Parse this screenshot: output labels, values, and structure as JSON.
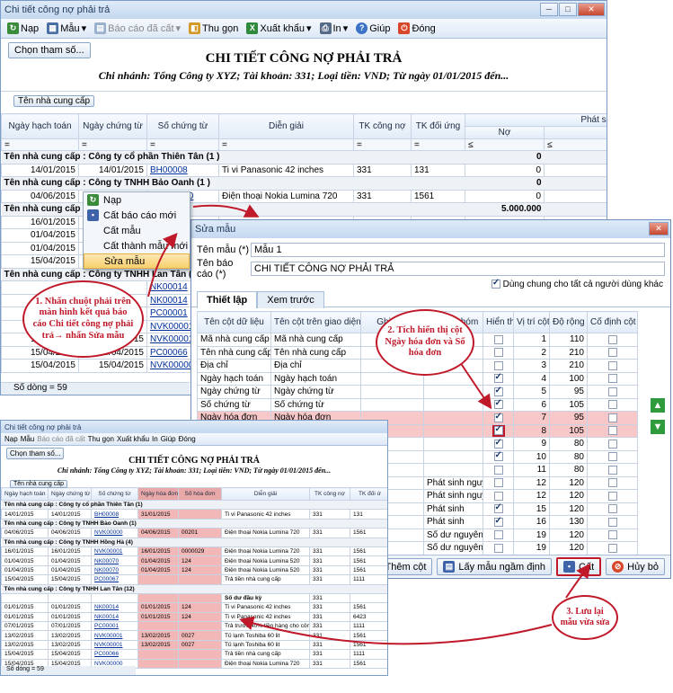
{
  "main": {
    "title": "Chi tiết công nợ phải trả",
    "toolbar": [
      "Nạp",
      "Mẫu",
      "Báo cáo đã cất",
      "Thu gọn",
      "Xuất khẩu",
      "In",
      "Giúp",
      "Đóng"
    ],
    "param_button": "Chọn tham số...",
    "report_title": "CHI TIẾT CÔNG NỢ PHẢI TRẢ",
    "report_sub": "Chi nhánh: Tổng Công ty XYZ; Tài khoản: 331; Loại tiền: VND; Từ ngày 01/01/2015 đến...",
    "group_chip": "Tên nhà cung cấp",
    "headers": [
      "Ngày hạch toán",
      "Ngày chứng từ",
      "Số chứng từ",
      "Diễn giải",
      "TK công nợ",
      "TK đối ứng",
      "Phát sinh",
      "Nợ",
      "Có"
    ],
    "filter_ops": [
      "=",
      "=",
      "=",
      "=",
      "=",
      "=",
      "≤",
      "≤"
    ],
    "rows": [
      {
        "g": "Tên nhà cung cấp : Công ty cổ phần Thiên Tân (1 )",
        "t": "0",
        "t2": "57"
      },
      {
        "d": [
          "14/01/2015",
          "14/01/2015",
          "BH00008",
          "Ti vi Panasonic 42 inches",
          "331",
          "131",
          "0",
          ""
        ]
      },
      {
        "g": "Tên nhà cung cấp : Công ty TNHH Bảo Oanh (1 )",
        "t": "0",
        "t2": "66"
      },
      {
        "d": [
          "04/06/2015",
          "",
          "NVK00000",
          "Điện thoại Nokia Lumina 720",
          "331",
          "1561",
          "0",
          ""
        ]
      },
      {
        "g": "Tên nhà cung cấp :",
        "t": "5.000.000",
        "t2": "80"
      },
      {
        "d": [
          "16/01/2015",
          "",
          "",
          "",
          "",
          "",
          "",
          ""
        ]
      },
      {
        "d": [
          "01/04/2015",
          "",
          "",
          "",
          "",
          "",
          "",
          ""
        ]
      },
      {
        "d": [
          "01/04/2015",
          "",
          "",
          "",
          "",
          "",
          "",
          ""
        ]
      },
      {
        "d": [
          "15/04/2015",
          "",
          "",
          "",
          "",
          "",
          "",
          ""
        ]
      },
      {
        "g": "Tên nhà cung cấp : Công ty TNHH Lan Tân (12)",
        "t": "",
        "t2": ""
      },
      {
        "d": [
          "",
          "",
          "NK00014",
          "",
          "",
          "",
          "",
          ""
        ]
      },
      {
        "d": [
          "",
          "",
          "NK00014",
          "",
          "",
          "",
          "",
          ""
        ]
      },
      {
        "d": [
          "",
          "",
          "PC00001",
          "",
          "",
          "",
          "",
          ""
        ]
      },
      {
        "d": [
          "",
          "",
          "NVK00001",
          "",
          "",
          "",
          "",
          ""
        ]
      },
      {
        "d": [
          "13/02/2015",
          "13/02/2015",
          "NVK00001",
          "",
          "",
          "",
          "",
          ""
        ]
      },
      {
        "d": [
          "15/04/2015",
          "15/04/2015",
          "PC00066",
          "",
          "",
          "",
          "",
          ""
        ]
      },
      {
        "d": [
          "15/04/2015",
          "15/04/2015",
          "NVK00000",
          "",
          "",
          "",
          "",
          ""
        ]
      }
    ],
    "footer": "Số dòng = 59"
  },
  "menu": {
    "items": [
      "Nạp",
      "Cất báo cáo mới",
      "Cất mẫu",
      "Cất thành mẫu mới",
      "Sửa mẫu"
    ]
  },
  "dialog": {
    "title": "Sửa mẫu",
    "name_label": "Tên mẫu (*)",
    "name_value": "Mẫu 1",
    "report_label": "Tên báo cáo (*)",
    "report_value": "CHI TIẾT CÔNG NỢ PHẢI TRẢ",
    "share_label": "Dùng chung cho tất cả người dùng khác",
    "tabs": [
      "Thiết lập",
      "Xem trước"
    ],
    "headers": [
      "Tên cột dữ liệu",
      "Tên cột trên giao diện",
      "Ghi chú",
      "Thuộc nhóm",
      "Hiển thị",
      "Vị trí cột",
      "Độ rộng",
      "Cố định cột"
    ],
    "rows": [
      [
        "Mã nhà cung cấp",
        "Mã nhà cung cấp",
        "",
        "",
        false,
        "1",
        "110",
        false
      ],
      [
        "Tên nhà cung cấp",
        "Tên nhà cung cấp",
        "",
        "",
        false,
        "2",
        "210",
        false
      ],
      [
        "Địa chỉ",
        "Địa chỉ",
        "",
        "",
        false,
        "3",
        "210",
        false
      ],
      [
        "Ngày hạch toán",
        "Ngày hạch toán",
        "",
        "",
        true,
        "4",
        "100",
        false
      ],
      [
        "Ngày chứng từ",
        "Ngày chứng từ",
        "",
        "",
        true,
        "5",
        "95",
        false
      ],
      [
        "Số chứng từ",
        "Số chứng từ",
        "",
        "",
        true,
        "6",
        "105",
        false
      ],
      [
        "Ngày hóa đơn",
        "Ngày hóa đơn",
        "",
        "",
        true,
        "7",
        "95",
        false
      ],
      [
        "Số hóa đơn",
        "Số hóa đơn",
        "",
        "",
        true,
        "8",
        "105",
        false
      ],
      [
        "",
        "",
        "",
        "",
        true,
        "9",
        "80",
        false
      ],
      [
        "",
        "",
        "",
        "",
        true,
        "10",
        "80",
        false
      ],
      [
        "",
        "",
        "",
        "",
        false,
        "11",
        "80",
        false
      ],
      [
        "",
        "",
        "",
        "Phát sinh nguyê...",
        false,
        "12",
        "120",
        false
      ],
      [
        "",
        "",
        "",
        "Phát sinh nguyê...",
        false,
        "12",
        "120",
        false
      ],
      [
        "",
        "",
        "",
        "Phát sinh",
        true,
        "15",
        "120",
        false
      ],
      [
        "",
        "",
        "",
        "Phát sinh",
        true,
        "16",
        "130",
        false
      ],
      [
        "",
        "",
        "",
        "Số dư nguyên tệ",
        false,
        "19",
        "120",
        false
      ],
      [
        "",
        "",
        "",
        "Số dư nguyên tệ",
        false,
        "19",
        "120",
        false
      ]
    ],
    "buttons": [
      "Thêm cột",
      "Lấy mẫu ngầm định",
      "Cất",
      "Hủy bỏ"
    ]
  },
  "preview": {
    "title": "Chi tiết công nợ phải trả",
    "toolbar": [
      "Nạp",
      "Mẫu",
      "Báo cáo đã cất",
      "Thu gọn",
      "Xuất khẩu",
      "In",
      "Giúp",
      "Đóng"
    ],
    "param_button": "Chọn tham số...",
    "report_title": "CHI TIẾT CÔNG NỢ PHẢI TRẢ",
    "report_sub": "Chi nhánh: Tổng Công ty XYZ; Tài khoản: 331; Loại tiền: VND; Từ ngày 01/01/2015 đến...",
    "group_chip": "Tên nhà cung cấp",
    "headers": [
      "Ngày hạch toán",
      "Ngày chứng từ",
      "Số chứng từ",
      "Ngày hóa đơn",
      "Số hóa đơn",
      "Diễn giải",
      "TK công nợ",
      "TK đối ứ"
    ],
    "rows": [
      {
        "g": "Tên nhà cung cấp : Công ty cổ phần Thiên Tân (1)"
      },
      {
        "d": [
          "14/01/2015",
          "14/01/2015",
          "BH00008",
          "31/01/2015",
          "",
          "Ti vi Panasonic 42 inches",
          "331",
          "131"
        ]
      },
      {
        "g": "Tên nhà cung cấp : Công ty TNHH Bảo Oanh (1)"
      },
      {
        "d": [
          "04/06/2015",
          "04/06/2015",
          "NVK00000",
          "04/06/2015",
          "00201",
          "Điện thoại Nokia Lumina 720",
          "331",
          "1561"
        ]
      },
      {
        "g": "Tên nhà cung cấp : Công ty TNHH Hồng Hà (4)"
      },
      {
        "d": [
          "16/01/2015",
          "16/01/2015",
          "NVK00001",
          "16/01/2015",
          "0000029",
          "Điện thoại Nokia Lumina 720",
          "331",
          "1561"
        ]
      },
      {
        "d": [
          "01/04/2015",
          "01/04/2015",
          "NK00070",
          "01/04/2015",
          "124",
          "Điện thoại Nokia Lumina 520",
          "331",
          "1561"
        ]
      },
      {
        "d": [
          "01/04/2015",
          "01/04/2015",
          "NK00070",
          "01/04/2015",
          "124",
          "Điện thoại Nokia Lumina 520",
          "331",
          "1561"
        ]
      },
      {
        "d": [
          "15/04/2015",
          "15/04/2015",
          "PC00067",
          "",
          "",
          "Trả tiền nhà cung cấp",
          "331",
          "1111"
        ]
      },
      {
        "g": "Tên nhà cung cấp : Công ty TNHH Lan Tân (12)"
      },
      {
        "d": [
          "",
          "",
          "",
          "",
          "",
          "Số dư đầu kỳ",
          "331",
          ""
        ]
      },
      {
        "d": [
          "01/01/2015",
          "01/01/2015",
          "NK00014",
          "01/01/2015",
          "124",
          "Ti vi Panasonic 42 inches",
          "331",
          "1561"
        ]
      },
      {
        "d": [
          "01/01/2015",
          "01/01/2015",
          "NK00014",
          "01/01/2015",
          "124",
          "Ti vi Panasonic 42 inches",
          "331",
          "6423"
        ]
      },
      {
        "d": [
          "07/01/2015",
          "07/01/2015",
          "PC00001",
          "",
          "",
          "Trả trước 40% tiền hàng cho công ty La",
          "331",
          "1111"
        ]
      },
      {
        "d": [
          "13/02/2015",
          "13/02/2015",
          "NVK00001",
          "13/02/2015",
          "0027",
          "Tủ lạnh Toshiba 60 lit",
          "331",
          "1561"
        ]
      },
      {
        "d": [
          "13/02/2015",
          "13/02/2015",
          "NVK00001",
          "13/02/2015",
          "0027",
          "Tủ lạnh Toshiba 60 lit",
          "331",
          "1561"
        ]
      },
      {
        "d": [
          "15/04/2015",
          "15/04/2015",
          "PC00066",
          "",
          "",
          "Trả tiền nhà cung cấp",
          "331",
          "1111"
        ]
      },
      {
        "d": [
          "15/04/2015",
          "15/04/2015",
          "NVK00000",
          "",
          "",
          "Điện thoại Nokia Lumina 720",
          "331",
          "1561"
        ]
      }
    ],
    "footer": "Số dòng = 59"
  },
  "callouts": {
    "c1": "1. Nhấn chuột phải trên màn hình kết quả báo cáo Chi tiết công nợ phải trả→ nhấn Sửa mẫu",
    "c2": "2. Tích hiển thị cột Ngày hóa đơn và Số hóa đơn",
    "c3": "3. Lưu lại mẫu vừa sửa"
  },
  "colors": {
    "callout": "#c0192a",
    "highlight": "#f8c8c8",
    "title_bar": "#c4d8f0"
  }
}
